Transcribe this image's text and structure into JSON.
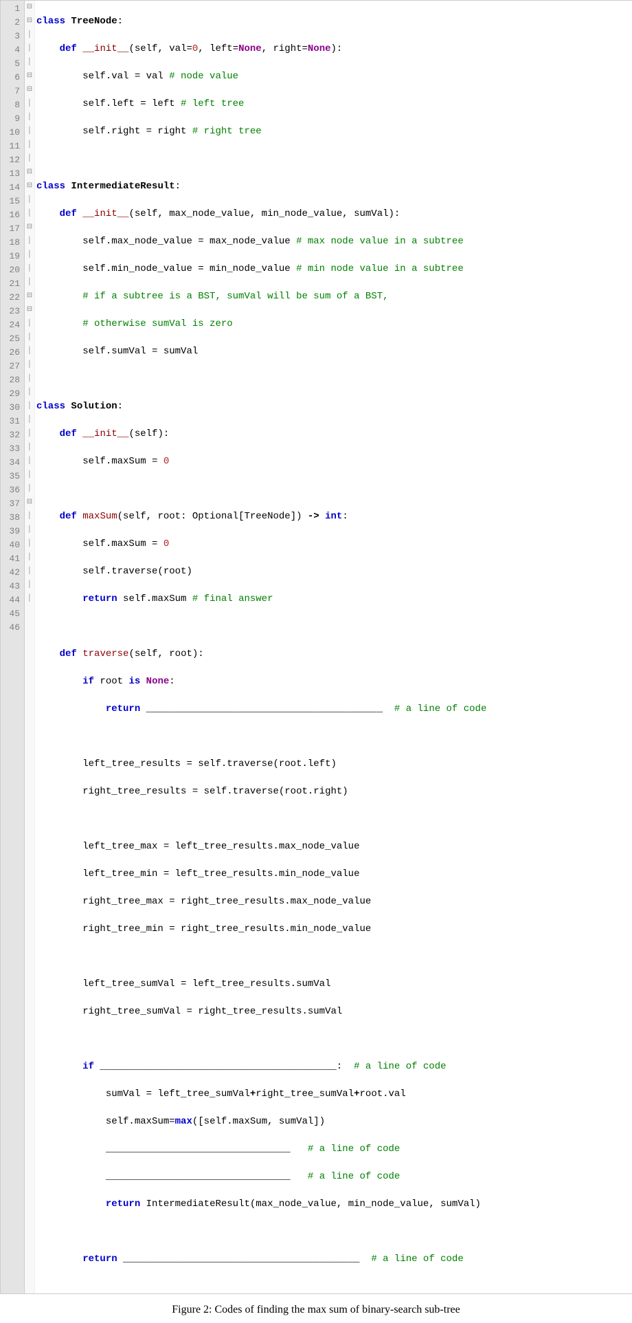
{
  "caption": "Figure 2: Codes of finding the max sum of binary-search sub-tree",
  "line_numbers": [
    "1",
    "2",
    "3",
    "4",
    "5",
    "6",
    "7",
    "8",
    "9",
    "10",
    "11",
    "12",
    "13",
    "14",
    "15",
    "16",
    "17",
    "18",
    "19",
    "20",
    "21",
    "22",
    "23",
    "24",
    "25",
    "26",
    "27",
    "28",
    "29",
    "30",
    "31",
    "32",
    "33",
    "34",
    "35",
    "36",
    "37",
    "38",
    "39",
    "40",
    "41",
    "42",
    "43",
    "44",
    "45",
    "46"
  ],
  "fold_marks": {
    "1": "⊟",
    "2": "⊟",
    "7": "⊟",
    "8": "⊟",
    "15": "⊟",
    "16": "⊟",
    "19": "⊟",
    "24": "⊟",
    "25": "⊟",
    "39": "⊟"
  },
  "code": {
    "l1_kw_class": "class",
    "l1_cls": "TreeNode",
    "l1_colon": ":",
    "l2_kw_def": "def",
    "l2_fn": "__init__",
    "l2_sig1": "(self, val=",
    "l2_num0": "0",
    "l2_sig2": ", left=",
    "l2_none1": "None",
    "l2_sig3": ", right=",
    "l2_none2": "None",
    "l2_sig4": "):",
    "l3_body": "self.val = val ",
    "l3_cmt": "# node value",
    "l4_body": "self.left = left ",
    "l4_cmt": "# left tree",
    "l5_body": "self.right = right ",
    "l5_cmt": "# right tree",
    "l7_kw_class": "class",
    "l7_cls": "IntermediateResult",
    "l7_colon": ":",
    "l8_kw_def": "def",
    "l8_fn": "__init__",
    "l8_sig": "(self, max_node_value, min_node_value, sumVal):",
    "l9_body": "self.max_node_value = max_node_value ",
    "l9_cmt": "# max node value in a subtree",
    "l10_body": "self.min_node_value = min_node_value ",
    "l10_cmt": "# min node value in a subtree",
    "l11_cmt": "# if a subtree is a BST, sumVal will be sum of a BST,",
    "l12_cmt": "# otherwise sumVal is zero",
    "l13_body": "self.sumVal = sumVal",
    "l15_kw_class": "class",
    "l15_cls": "Solution",
    "l15_colon": ":",
    "l16_kw_def": "def",
    "l16_fn": "__init__",
    "l16_sig": "(self):",
    "l17_body": "self.maxSum = ",
    "l17_num": "0",
    "l19_kw_def": "def",
    "l19_fn": "maxSum",
    "l19_sig1": "(self, root: Optional[TreeNode]) ",
    "l19_arrow": "->",
    "l19_sig2": " ",
    "l19_int": "int",
    "l19_colon": ":",
    "l20_body": "self.maxSum = ",
    "l20_num": "0",
    "l21_body": "self.traverse(root)",
    "l22_kw": "return",
    "l22_body": " self.maxSum ",
    "l22_cmt": "# final answer",
    "l24_kw_def": "def",
    "l24_fn": "traverse",
    "l24_sig": "(self, root):",
    "l25_kw_if": "if",
    "l25_body": " root ",
    "l25_kw_is": "is",
    "l25_none": "None",
    "l25_colon": ":",
    "l26_kw": "return",
    "l26_blank": " _________________________________________  ",
    "l26_cmt": "# a line of code",
    "l28_body": "left_tree_results = self.traverse(root.left)",
    "l29_body": "right_tree_results = self.traverse(root.right)",
    "l31_body": "left_tree_max = left_tree_results.max_node_value",
    "l32_body": "left_tree_min = left_tree_results.min_node_value",
    "l33_body": "right_tree_max = right_tree_results.max_node_value",
    "l34_body": "right_tree_min = right_tree_results.min_node_value",
    "l36_body": "left_tree_sumVal = left_tree_results.sumVal",
    "l37_body": "right_tree_sumVal = right_tree_results.sumVal",
    "l39_kw_if": "if",
    "l39_blank": " _________________________________________:  ",
    "l39_cmt": "# a line of code",
    "l40_body": "sumVal = left_tree_sumVal",
    "l40_plus1": "+",
    "l40_body2": "right_tree_sumVal",
    "l40_plus2": "+",
    "l40_body3": "root.val",
    "l41_body1": "self.maxSum=",
    "l41_max": "max",
    "l41_body2": "([self.maxSum, sumVal])",
    "l42_blank": "________________________________   ",
    "l42_cmt": "# a line of code",
    "l43_blank": "________________________________   ",
    "l43_cmt": "# a line of code",
    "l44_kw": "return",
    "l44_body": " IntermediateResult(max_node_value, min_node_value, sumVal)",
    "l46_kw": "return",
    "l46_blank": " _________________________________________  ",
    "l46_cmt": "# a line of code"
  }
}
